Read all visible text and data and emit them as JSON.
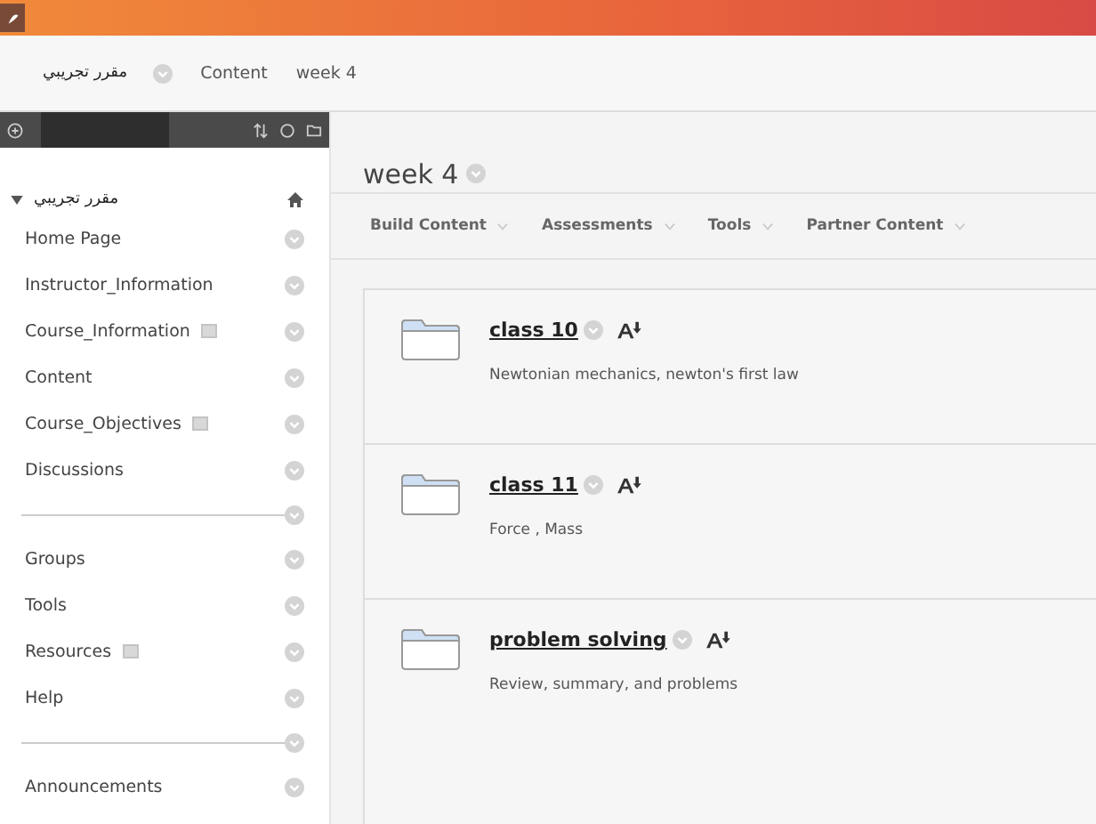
{
  "breadcrumbs": [
    {
      "label": "مقرر تجريبي",
      "kind": "course"
    },
    {
      "label": "Content",
      "kind": "plain"
    },
    {
      "label": "week 4",
      "kind": "plain"
    }
  ],
  "sidebar": {
    "course_title": "مقرر تجريبي",
    "items": [
      {
        "kind": "link",
        "label": "Home Page",
        "marked": false
      },
      {
        "kind": "link",
        "label": "Instructor_Information",
        "marked": false
      },
      {
        "kind": "link",
        "label": "Course_Information",
        "marked": true
      },
      {
        "kind": "link",
        "label": "Content",
        "marked": false
      },
      {
        "kind": "link",
        "label": "Course_Objectives",
        "marked": true
      },
      {
        "kind": "link",
        "label": "Discussions",
        "marked": false
      },
      {
        "kind": "divider"
      },
      {
        "kind": "link",
        "label": "Groups",
        "marked": false
      },
      {
        "kind": "link",
        "label": "Tools",
        "marked": false
      },
      {
        "kind": "link",
        "label": "Resources",
        "marked": true
      },
      {
        "kind": "link",
        "label": "Help",
        "marked": false
      },
      {
        "kind": "divider"
      },
      {
        "kind": "link",
        "label": "Announcements",
        "marked": false
      }
    ]
  },
  "page": {
    "title": "week 4",
    "actions": [
      "Build Content",
      "Assessments",
      "Tools",
      "Partner Content"
    ],
    "items": [
      {
        "title": "class 10",
        "description": "Newtonian mechanics, newton's first law"
      },
      {
        "title": "class 11",
        "description": "Force , Mass"
      },
      {
        "title": "problem solving",
        "description": "Review, summary, and problems"
      }
    ]
  }
}
